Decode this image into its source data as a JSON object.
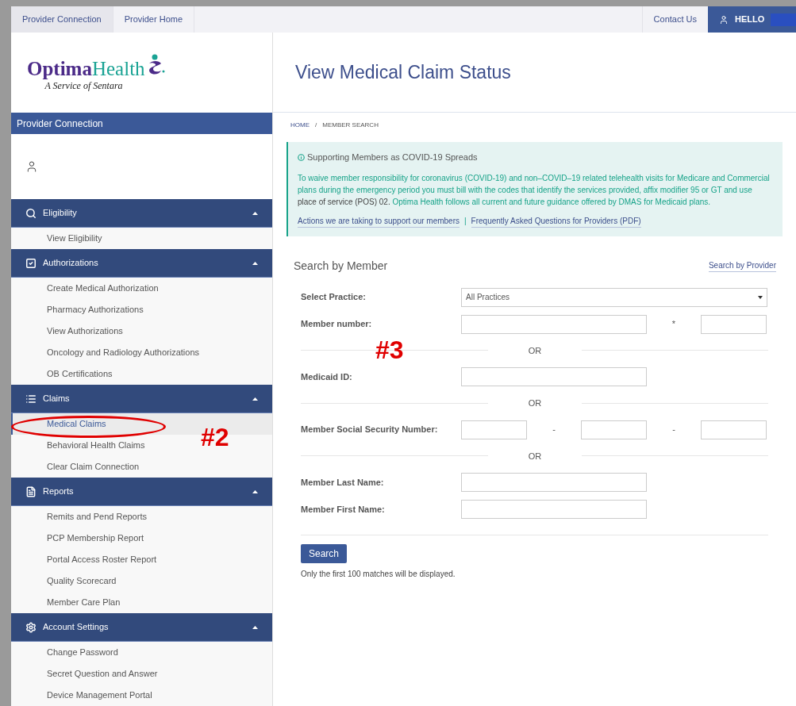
{
  "top_nav": {
    "tabs": [
      {
        "label": "Provider Connection",
        "selected": true
      },
      {
        "label": "Provider Home",
        "selected": false
      }
    ],
    "contact": "Contact Us",
    "greeting": "HELLO"
  },
  "logo": {
    "first": "Optima",
    "second": "Health",
    "tagline": "A Service of Sentara"
  },
  "sidebar": {
    "title": "Provider Connection",
    "groups": [
      {
        "label": "Eligibility",
        "expanded": true,
        "items": [
          {
            "label": "View Eligibility",
            "selected": false
          }
        ]
      },
      {
        "label": "Authorizations",
        "expanded": true,
        "items": [
          {
            "label": "Create Medical Authorization",
            "selected": false
          },
          {
            "label": "Pharmacy Authorizations",
            "selected": false
          },
          {
            "label": "View Authorizations",
            "selected": false
          },
          {
            "label": "Oncology and Radiology Authorizations",
            "selected": false
          },
          {
            "label": "OB Certifications",
            "selected": false
          }
        ]
      },
      {
        "label": "Claims",
        "expanded": true,
        "items": [
          {
            "label": "Medical Claims",
            "selected": true
          },
          {
            "label": "Behavioral Health Claims",
            "selected": false
          },
          {
            "label": "Clear Claim Connection",
            "selected": false
          }
        ]
      },
      {
        "label": "Reports",
        "expanded": true,
        "items": [
          {
            "label": "Remits and Pend Reports",
            "selected": false
          },
          {
            "label": "PCP Membership Report",
            "selected": false
          },
          {
            "label": "Portal Access Roster Report",
            "selected": false
          },
          {
            "label": "Quality Scorecard",
            "selected": false
          },
          {
            "label": "Member Care Plan",
            "selected": false
          }
        ]
      },
      {
        "label": "Account Settings",
        "expanded": true,
        "items": [
          {
            "label": "Change Password",
            "selected": false
          },
          {
            "label": "Secret Question and Answer",
            "selected": false
          },
          {
            "label": "Device Management Portal",
            "selected": false
          }
        ]
      }
    ]
  },
  "page_title": "View Medical Claim Status",
  "breadcrumb": [
    {
      "label": "HOME",
      "kind": "link"
    },
    {
      "label": "/",
      "kind": "separator"
    },
    {
      "label": "MEMBER SEARCH",
      "kind": "current"
    }
  ],
  "notice": {
    "title": "Supporting Members as COVID-19 Spreads",
    "body": [
      {
        "text": "To waive member responsibility for coronavirus (COVID-19) and non–COVID–19 related telehealth visits for Medicare and Commercial plans during the emergency period you must bill with the codes that identify the services provided, affix modifier 95 or GT and use ",
        "emphasis": false
      },
      {
        "text": "place of service (POS) 02.",
        "emphasis": true
      },
      {
        "text": " Optima Health follows all current and future guidance offered by DMAS for Medicaid plans.",
        "emphasis": false
      }
    ],
    "links": [
      {
        "label": "Actions we are taking to support our members",
        "kind": "link"
      },
      {
        "label": "|",
        "kind": "separator"
      },
      {
        "label": "Frequently Asked Questions for Providers (PDF)",
        "kind": "link"
      }
    ]
  },
  "search": {
    "title": "Search by Member",
    "alt_link": "Search by Provider",
    "rows": [
      {
        "kind": "select",
        "label": "Select Practice:",
        "value": "All Practices"
      },
      {
        "kind": "fields",
        "label": "Member number:",
        "parts": [
          {
            "kind": "wide-input"
          },
          {
            "kind": "separator",
            "text": "*"
          },
          {
            "kind": "input"
          }
        ]
      },
      {
        "kind": "or",
        "text": "OR"
      },
      {
        "kind": "fields",
        "label": "Medicaid ID:",
        "parts": [
          {
            "kind": "wide-input"
          }
        ]
      },
      {
        "kind": "or",
        "text": "OR"
      },
      {
        "kind": "fields",
        "label": "Member Social Security Number:",
        "parts": [
          {
            "kind": "input"
          },
          {
            "kind": "separator",
            "text": "-"
          },
          {
            "kind": "input"
          },
          {
            "kind": "separator",
            "text": "-"
          },
          {
            "kind": "input"
          }
        ]
      },
      {
        "kind": "or",
        "text": "OR"
      },
      {
        "kind": "fields",
        "label": "Member Last Name:",
        "parts": [
          {
            "kind": "wide-input"
          }
        ]
      },
      {
        "kind": "fields",
        "label": "Member First Name:",
        "parts": [
          {
            "kind": "wide-input"
          }
        ]
      }
    ],
    "button": "Search",
    "note": "Only the first 100 matches will be displayed."
  },
  "annotations": [
    {
      "kind": "ellipse"
    },
    {
      "kind": "label",
      "text": "#2"
    },
    {
      "kind": "label",
      "text": "#3"
    }
  ]
}
